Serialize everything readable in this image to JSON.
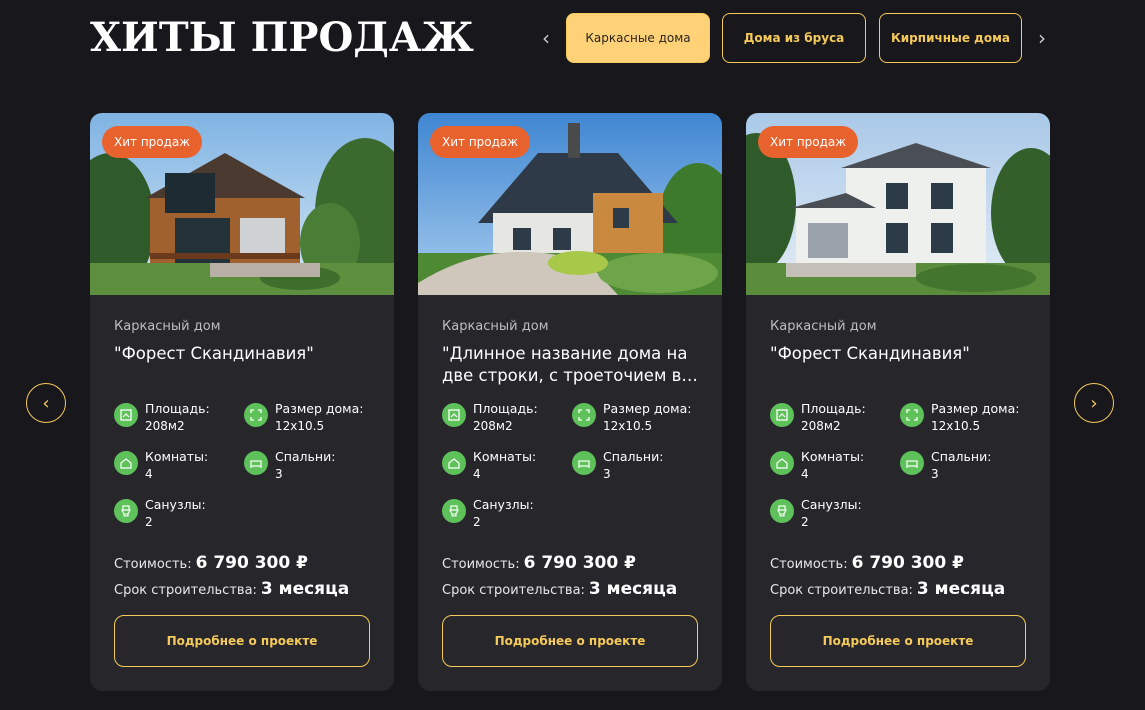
{
  "section": {
    "title": "ХИТЫ ПРОДАЖ"
  },
  "tabs": [
    {
      "label": "Каркасные дома",
      "active": true
    },
    {
      "label": "Дома из бруса",
      "active": false
    },
    {
      "label": "Кирпичные дома",
      "active": false
    }
  ],
  "icons": {
    "tabs_prev": "‹",
    "tabs_next": "›",
    "carousel_prev": "‹",
    "carousel_next": "›"
  },
  "colors": {
    "accent": "#f5c95a",
    "badge": "#e8622e",
    "spec_icon": "#5ec15a",
    "card_bg": "#26262b",
    "page_bg": "#18171c"
  },
  "cards": [
    {
      "badge": "Хит продаж",
      "type": "Каркасный дом",
      "name": "\"Форест Скандинавия\"",
      "area_label": "Площадь:",
      "area_value": "208м2",
      "size_label": "Размер дома:",
      "size_value": "12х10.5",
      "rooms_label": "Комнаты:",
      "rooms_value": "4",
      "bedrooms_label": "Спальни:",
      "bedrooms_value": "3",
      "bathrooms_label": "Санузлы:",
      "bathrooms_value": "2",
      "price_label": "Стоимость:",
      "price_value": "6 790 300 ₽",
      "term_label": "Срок строительства:",
      "term_value": "3 месяца",
      "button": "Подробнее о проекте"
    },
    {
      "badge": "Хит продаж",
      "type": "Каркасный дом",
      "name": "\"Длинное название дома на две строки, с троеточием в конце\"",
      "area_label": "Площадь:",
      "area_value": "208м2",
      "size_label": "Размер дома:",
      "size_value": "12х10.5",
      "rooms_label": "Комнаты:",
      "rooms_value": "4",
      "bedrooms_label": "Спальни:",
      "bedrooms_value": "3",
      "bathrooms_label": "Санузлы:",
      "bathrooms_value": "2",
      "price_label": "Стоимость:",
      "price_value": "6 790 300 ₽",
      "term_label": "Срок строительства:",
      "term_value": "3 месяца",
      "button": "Подробнее о проекте"
    },
    {
      "badge": "Хит продаж",
      "type": "Каркасный дом",
      "name": "\"Форест Скандинавия\"",
      "area_label": "Площадь:",
      "area_value": "208м2",
      "size_label": "Размер дома:",
      "size_value": "12х10.5",
      "rooms_label": "Комнаты:",
      "rooms_value": "4",
      "bedrooms_label": "Спальни:",
      "bedrooms_value": "3",
      "bathrooms_label": "Санузлы:",
      "bathrooms_value": "2",
      "price_label": "Стоимость:",
      "price_value": "6 790 300 ₽",
      "term_label": "Срок строительства:",
      "term_value": "3 месяца",
      "button": "Подробнее о проекте"
    }
  ]
}
